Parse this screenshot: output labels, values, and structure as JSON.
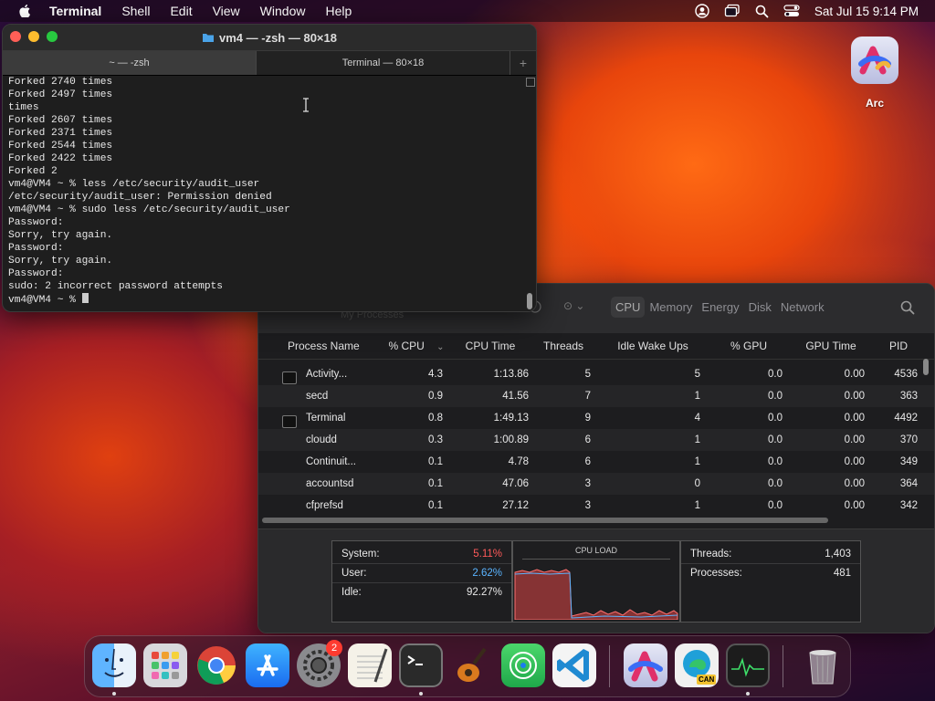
{
  "menubar": {
    "app_name": "Terminal",
    "items": [
      "Shell",
      "Edit",
      "View",
      "Window",
      "Help"
    ],
    "datetime": "Sat Jul 15  9:14 PM"
  },
  "terminal": {
    "title": "vm4 — -zsh — 80×18",
    "tabs": [
      "~ — -zsh",
      "Terminal — 80×18"
    ],
    "lines": [
      "Forked 2740 times",
      "Forked 2497 times",
      "times",
      "Forked 2607 times",
      "Forked 2371 times",
      "Forked 2544 times",
      "Forked 2422 times",
      "Forked 2",
      "vm4@VM4 ~ % less /etc/security/audit_user",
      "/etc/security/audit_user: Permission denied",
      "vm4@VM4 ~ % sudo less /etc/security/audit_user",
      "Password:",
      "Sorry, try again.",
      "Password:",
      "Sorry, try again.",
      "Password:",
      "sudo: 2 incorrect password attempts"
    ],
    "prompt": "vm4@VM4 ~ % "
  },
  "activity_monitor": {
    "subtitle": "My Processes",
    "tabs": [
      "CPU",
      "Memory",
      "Energy",
      "Disk",
      "Network"
    ],
    "selected_tab": "CPU",
    "columns": [
      "Process Name",
      "% CPU",
      "CPU Time",
      "Threads",
      "Idle Wake Ups",
      "% GPU",
      "GPU Time",
      "PID"
    ],
    "rows": [
      {
        "name": "Activity...",
        "cpu": "4.3",
        "time": "1:13.86",
        "threads": "5",
        "idle": "5",
        "gpu": "0.0",
        "gtime": "0.00",
        "pid": "4536"
      },
      {
        "name": "secd",
        "cpu": "0.9",
        "time": "41.56",
        "threads": "7",
        "idle": "1",
        "gpu": "0.0",
        "gtime": "0.00",
        "pid": "363"
      },
      {
        "name": "Terminal",
        "cpu": "0.8",
        "time": "1:49.13",
        "threads": "9",
        "idle": "4",
        "gpu": "0.0",
        "gtime": "0.00",
        "pid": "4492"
      },
      {
        "name": "cloudd",
        "cpu": "0.3",
        "time": "1:00.89",
        "threads": "6",
        "idle": "1",
        "gpu": "0.0",
        "gtime": "0.00",
        "pid": "370"
      },
      {
        "name": "Continuit...",
        "cpu": "0.1",
        "time": "4.78",
        "threads": "6",
        "idle": "1",
        "gpu": "0.0",
        "gtime": "0.00",
        "pid": "349"
      },
      {
        "name": "accountsd",
        "cpu": "0.1",
        "time": "47.06",
        "threads": "3",
        "idle": "0",
        "gpu": "0.0",
        "gtime": "0.00",
        "pid": "364"
      },
      {
        "name": "cfprefsd",
        "cpu": "0.1",
        "time": "27.12",
        "threads": "3",
        "idle": "1",
        "gpu": "0.0",
        "gtime": "0.00",
        "pid": "342"
      }
    ],
    "summary": {
      "system_label": "System:",
      "system_value": "5.11%",
      "user_label": "User:",
      "user_value": "2.62%",
      "idle_label": "Idle:",
      "idle_value": "92.27%",
      "cpu_load_title": "CPU LOAD",
      "threads_label": "Threads:",
      "threads_value": "1,403",
      "processes_label": "Processes:",
      "processes_value": "481"
    },
    "colors": {
      "system": "#ff5a5a",
      "user": "#5ab4ff"
    }
  },
  "desktop": {
    "arc_label": "Arc"
  },
  "dock": {
    "apps": [
      "Finder",
      "Launchpad",
      "Google Chrome",
      "App Store",
      "System Settings",
      "TextEdit",
      "Terminal",
      "GarageBand",
      "Find My",
      "Visual Studio Code",
      "Arc",
      "Microsoft Edge Canary",
      "Activity Monitor",
      "Trash"
    ],
    "settings_badge": "2",
    "edge_badge": "CAN"
  }
}
